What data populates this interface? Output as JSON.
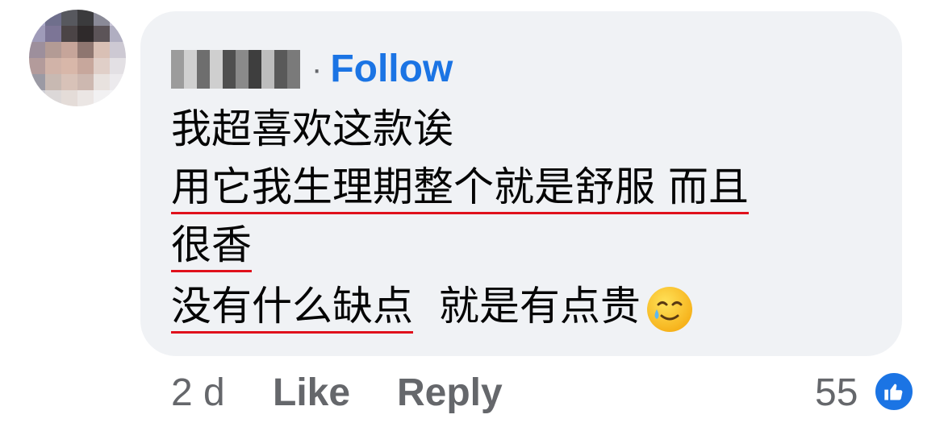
{
  "comment": {
    "author_name": "",
    "separator": "·",
    "follow_label": "Follow",
    "lines": [
      "我超喜欢这款诶",
      "用它我生理期整个就是舒服 而且",
      "很香",
      "没有什么缺点",
      "就是有点贵"
    ],
    "emoji_icon": "smiling-face-with-tear-icon"
  },
  "footer": {
    "timestamp": "2 d",
    "like_label": "Like",
    "reply_label": "Reply",
    "reaction_count": "55",
    "reaction_icon": "thumbs-up-icon"
  },
  "colors": {
    "bubble": "#f0f2f5",
    "follow": "#1b74e4",
    "underline": "#e0111c",
    "muted": "#65676b"
  }
}
